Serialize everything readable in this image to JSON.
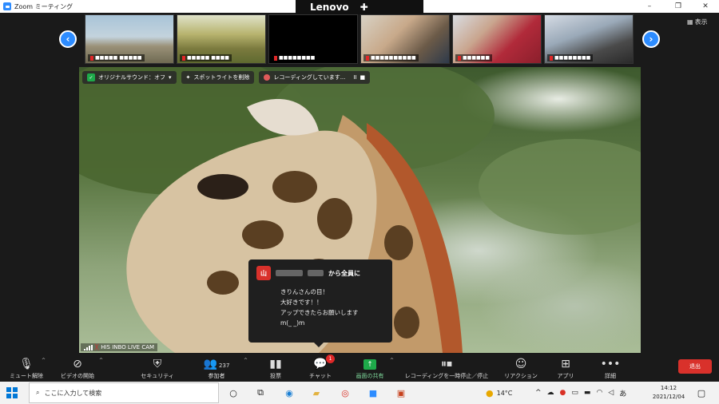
{
  "window": {
    "title": "Zoom ミーティング",
    "minimize": "–",
    "restore": "❐",
    "close": "✕"
  },
  "overlay": {
    "lenovo": "Lenovo"
  },
  "thumbnails": {
    "prev_arrow": "‹",
    "next_arrow": "›",
    "view_label": "表示",
    "items": [
      {
        "name": "■■■■■ ■■■■■"
      },
      {
        "name": "■■■■■ ■■■■"
      },
      {
        "name": "■■■■■■■■"
      },
      {
        "name": "■■■■■■■■■■"
      },
      {
        "name": "■■■■■■"
      },
      {
        "name": "■■■■■■■■"
      }
    ]
  },
  "main_video": {
    "original_sound": "オリジナルサウンド：オフ",
    "spotlight": "スポットライトを削除",
    "recording": "レコーディングしています...",
    "pause_icon": "II",
    "stop_icon": "■",
    "participant_label": "HIS INBO LIVE CAM"
  },
  "chat_popup": {
    "avatar": "山",
    "to_everyone": "から全員に",
    "lines": [
      "きりんさんの目！",
      "大好きです！！",
      "アップできたらお願いします",
      "m(_ _)m"
    ]
  },
  "toolbar": {
    "unmute": "ミュート解除",
    "start_video": "ビデオの開始",
    "security": "セキュリティ",
    "participants": "参加者",
    "participants_count": "237",
    "polls": "投票",
    "chat": "チャット",
    "chat_badge": "1",
    "share_screen": "画面の共有",
    "recording_pause": "レコーディングを一時停止／停止",
    "reactions": "リアクション",
    "apps": "アプリ",
    "more": "詳細",
    "end": "退出"
  },
  "taskbar": {
    "search_placeholder": "ここに入力して検索",
    "weather": "14°C",
    "ime": "あ",
    "time": "14:12",
    "date": "2021/12/04"
  },
  "colors": {
    "zoom_blue": "#2d8cff",
    "end_red": "#d9312b",
    "share_green": "#1eaa4a",
    "badge_red": "#e02828"
  }
}
